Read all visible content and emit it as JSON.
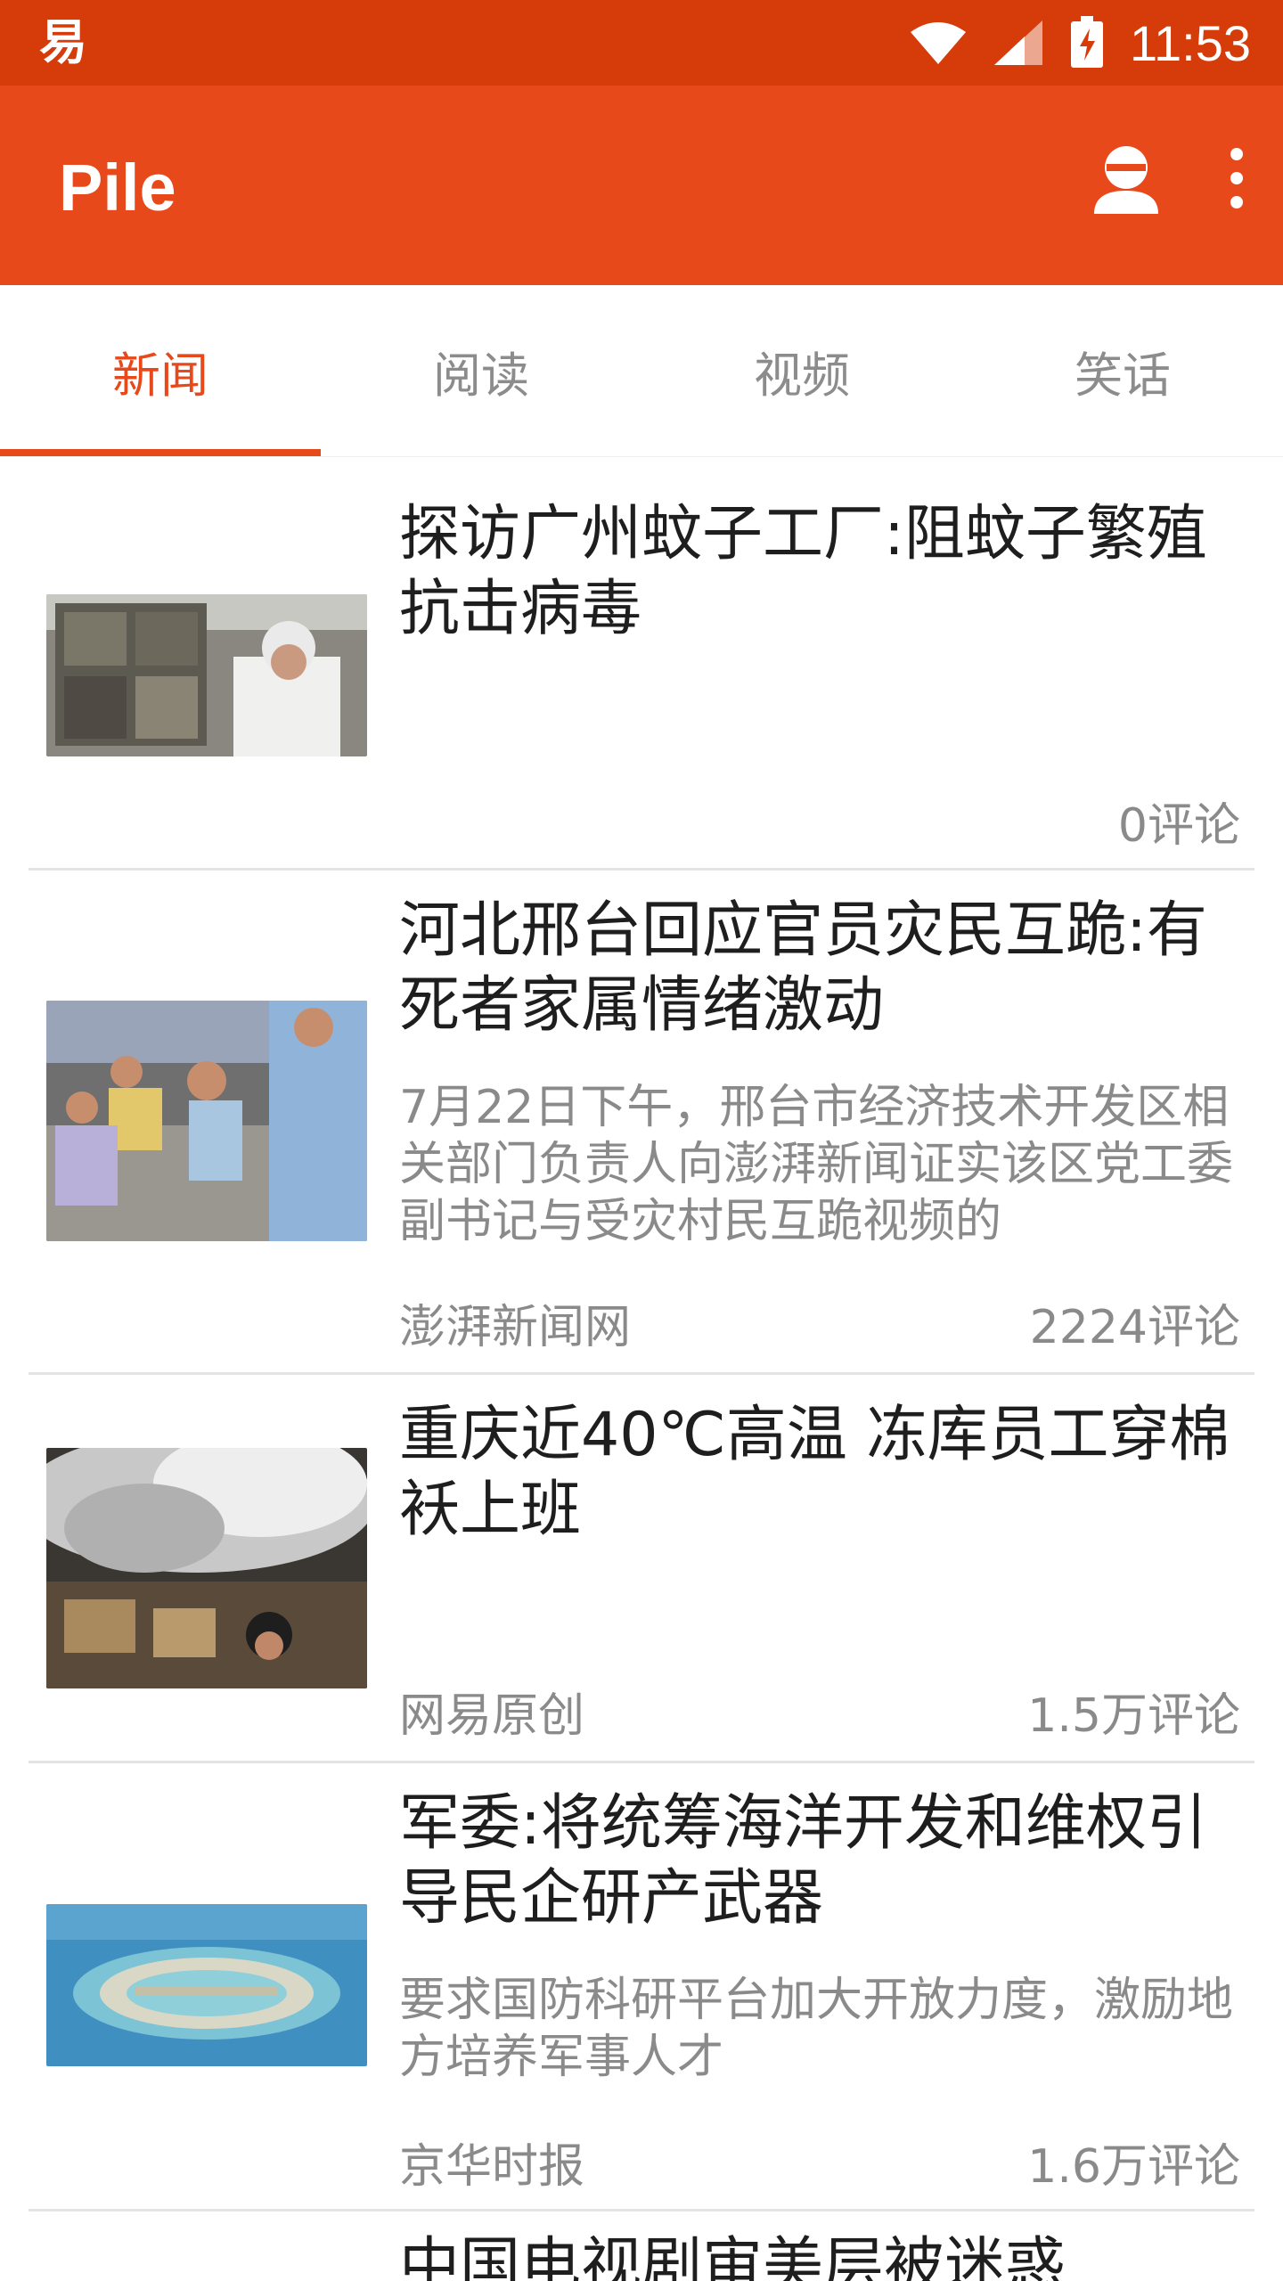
{
  "status_bar": {
    "app_icon_glyph": "易",
    "time": "11:53"
  },
  "app_bar": {
    "title": "Pile"
  },
  "tabs": [
    {
      "label": "新闻",
      "active": true
    },
    {
      "label": "阅读",
      "active": false
    },
    {
      "label": "视频",
      "active": false
    },
    {
      "label": "笑话",
      "active": false
    }
  ],
  "articles": [
    {
      "title": "探访广州蚊子工厂:阻蚊子繁殖抗击病毒",
      "summary": "",
      "source": "",
      "comments": "0评论"
    },
    {
      "title": "河北邢台回应官员灾民互跪:有死者家属情绪激动",
      "summary": "7月22日下午，邢台市经济技术开发区相关部门负责人向澎湃新闻证实该区党工委副书记与受灾村民互跪视频的",
      "source": "澎湃新闻网",
      "comments": "2224评论"
    },
    {
      "title": "重庆近40℃高温 冻库员工穿棉袄上班",
      "summary": "",
      "source": "网易原创",
      "comments": "1.5万评论"
    },
    {
      "title": "军委:将统筹海洋开发和维权引导民企研产武器",
      "summary": "要求国防科研平台加大开放力度，激励地方培养军事人才",
      "source": "京华时报",
      "comments": "1.6万评论"
    },
    {
      "title": "中国电视剧审美层被迷惑",
      "summary": "",
      "source": "",
      "comments": ""
    }
  ],
  "colors": {
    "status_bar": "#d63c0a",
    "app_bar": "#e8491a",
    "accent": "#e8491a",
    "divider": "#e4e4e4"
  },
  "icons": {
    "wifi": "wifi-icon",
    "signal": "signal-icon",
    "battery": "battery-charging-icon",
    "profile": "profile-icon",
    "overflow": "overflow-menu-icon"
  }
}
